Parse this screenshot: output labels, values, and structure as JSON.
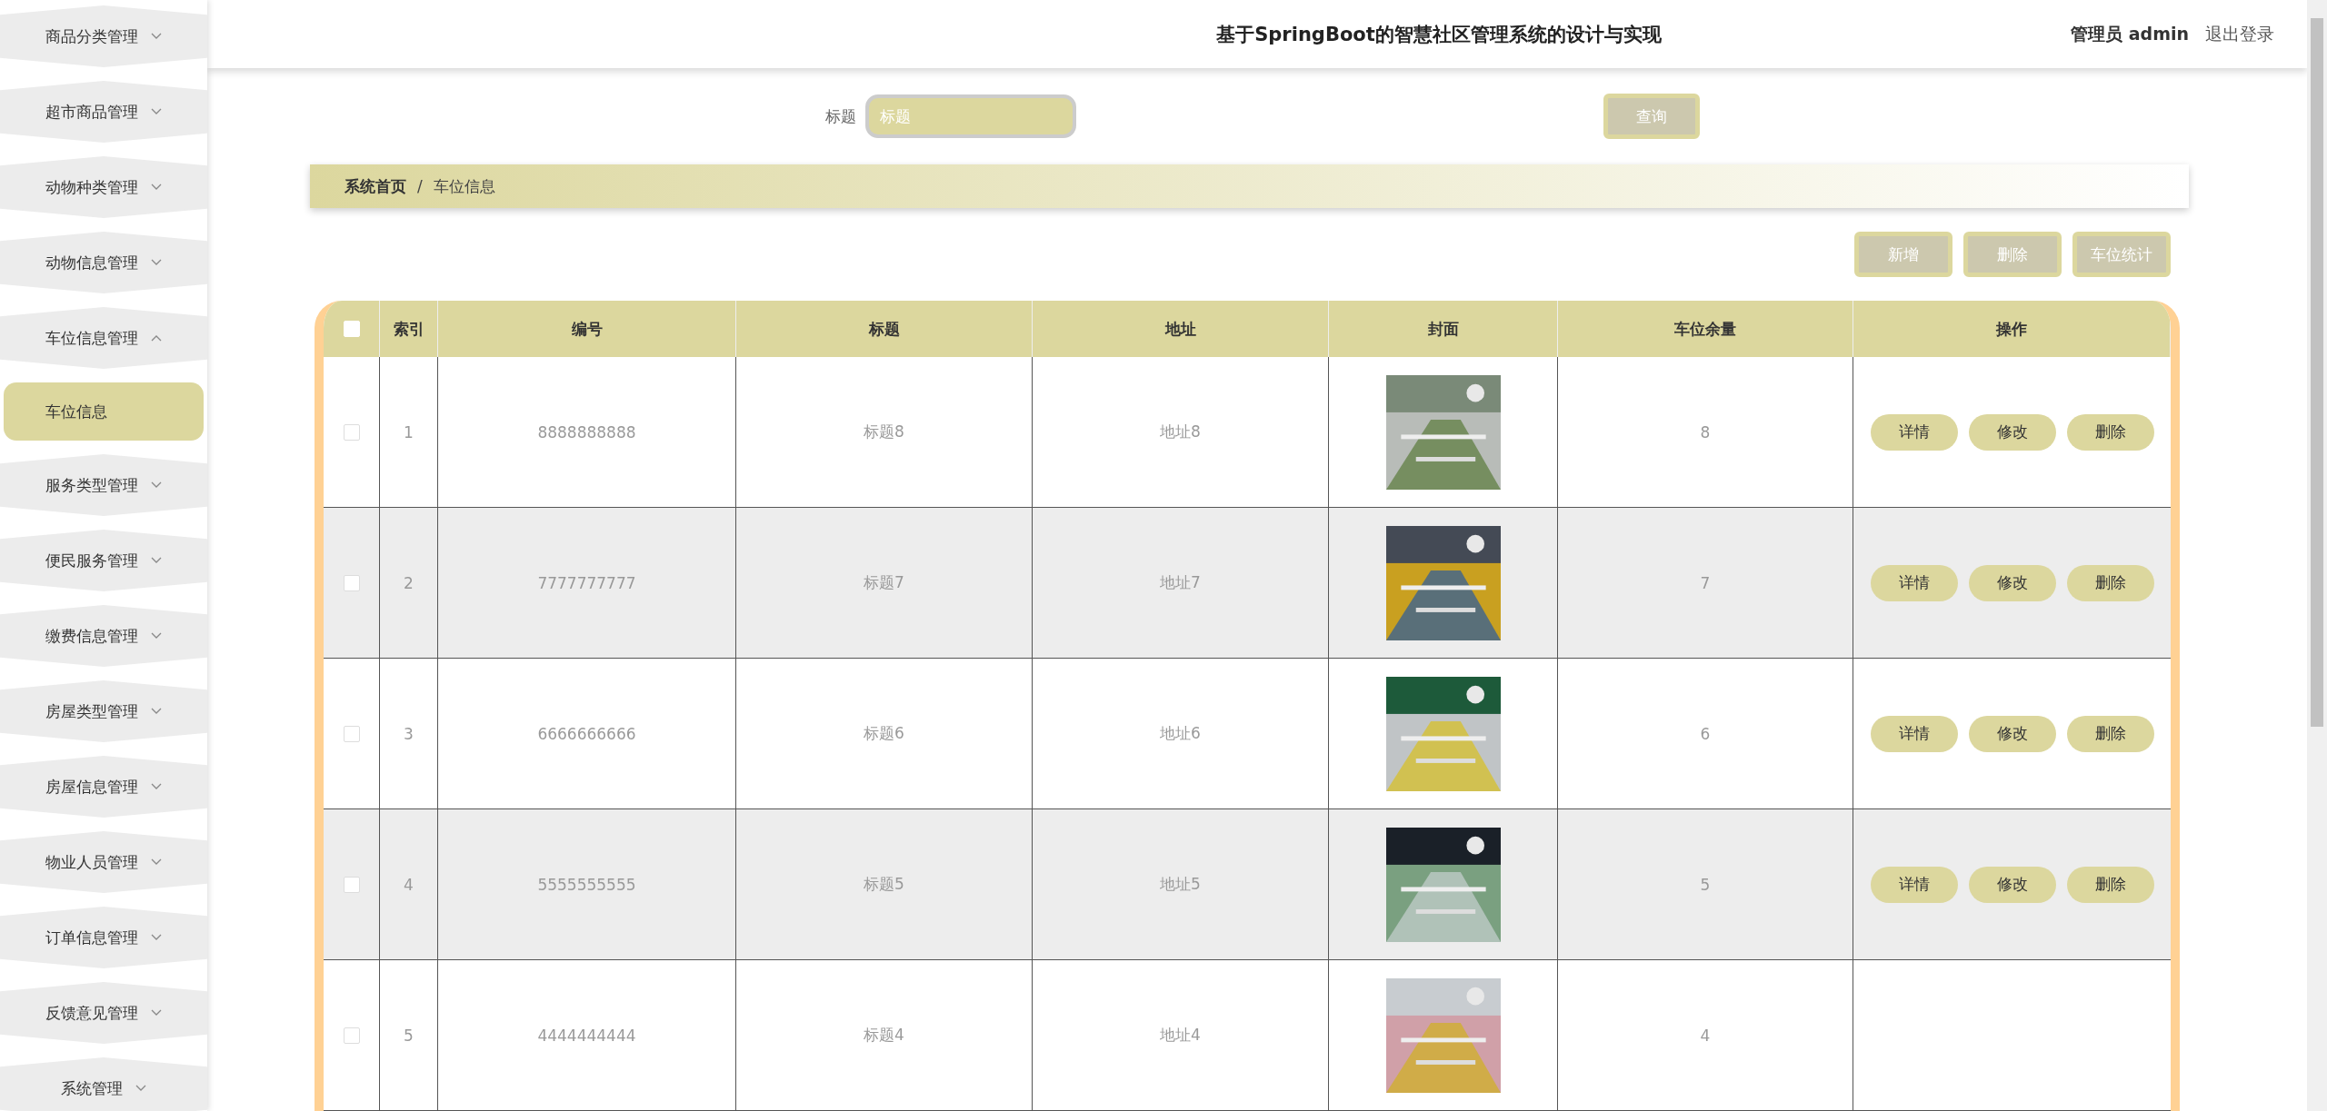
{
  "sidebar": {
    "items": [
      {
        "label": "商品分类管理",
        "expanded": false
      },
      {
        "label": "超市商品管理",
        "expanded": false
      },
      {
        "label": "动物种类管理",
        "expanded": false
      },
      {
        "label": "动物信息管理",
        "expanded": false
      },
      {
        "label": "车位信息管理",
        "expanded": true,
        "children": [
          {
            "label": "车位信息",
            "selected": true
          }
        ]
      },
      {
        "label": "服务类型管理",
        "expanded": false
      },
      {
        "label": "便民服务管理",
        "expanded": false
      },
      {
        "label": "缴费信息管理",
        "expanded": false
      },
      {
        "label": "房屋类型管理",
        "expanded": false
      },
      {
        "label": "房屋信息管理",
        "expanded": false
      },
      {
        "label": "物业人员管理",
        "expanded": false
      },
      {
        "label": "订单信息管理",
        "expanded": false
      },
      {
        "label": "反馈意见管理",
        "expanded": false
      },
      {
        "label": "系统管理",
        "expanded": false
      }
    ]
  },
  "header": {
    "title": "基于SpringBoot的智慧社区管理系统的设计与实现",
    "user": "管理员 admin",
    "logout": "退出登录"
  },
  "search": {
    "label": "标题",
    "placeholder": "标题",
    "button": "查询"
  },
  "breadcrumb": [
    "系统首页",
    "/",
    "车位信息"
  ],
  "actions": [
    "新增",
    "删除",
    "车位统计"
  ],
  "table": {
    "select_all_checked": false,
    "columns": [
      "索引",
      "编号",
      "标题",
      "地址",
      "封面",
      "车位余量",
      "操作"
    ],
    "rows": [
      {
        "checked": false,
        "cells": [
          "1",
          "8888888888",
          "标题8",
          "地址8",
          "8"
        ],
        "buttons": [
          "详情",
          "修改",
          "删除"
        ]
      },
      {
        "checked": false,
        "cells": [
          "2",
          "7777777777",
          "标题7",
          "地址7",
          "7"
        ],
        "buttons": [
          "详情",
          "修改",
          "删除"
        ]
      },
      {
        "checked": false,
        "cells": [
          "3",
          "6666666666",
          "标题6",
          "地址6",
          "6"
        ],
        "buttons": [
          "详情",
          "修改",
          "删除"
        ]
      },
      {
        "checked": false,
        "cells": [
          "4",
          "5555555555",
          "标题5",
          "地址5",
          "5"
        ],
        "buttons": [
          "详情",
          "修改",
          "删除"
        ]
      },
      {
        "checked": false,
        "cells": [
          "5",
          "4444444444",
          "标题4",
          "地址4",
          "4"
        ]
      }
    ]
  }
}
